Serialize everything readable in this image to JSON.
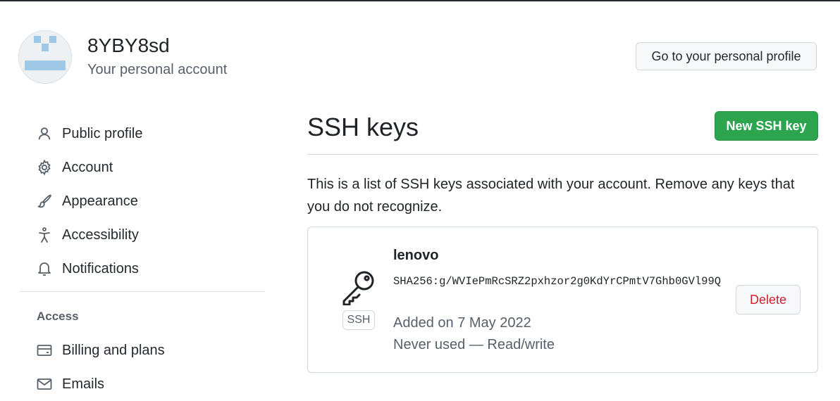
{
  "account": {
    "username": "8YBY8sd",
    "subtitle": "Your personal account",
    "profile_button": "Go to your personal profile"
  },
  "sidebar": {
    "items": [
      {
        "label": "Public profile",
        "icon": "person-icon"
      },
      {
        "label": "Account",
        "icon": "gear-icon"
      },
      {
        "label": "Appearance",
        "icon": "paintbrush-icon"
      },
      {
        "label": "Accessibility",
        "icon": "accessibility-icon"
      },
      {
        "label": "Notifications",
        "icon": "bell-icon"
      }
    ],
    "access_heading": "Access",
    "access_items": [
      {
        "label": "Billing and plans",
        "icon": "credit-card-icon"
      },
      {
        "label": "Emails",
        "icon": "mail-icon"
      }
    ]
  },
  "main": {
    "title": "SSH keys",
    "new_key_button": "New SSH key",
    "description": "This is a list of SSH keys associated with your account. Remove any keys that you do not recognize."
  },
  "keys": [
    {
      "name": "lenovo",
      "type_label": "SSH",
      "fingerprint": "SHA256:g/WVIePmRcSRZ2pxhzor2g0KdYrCPmtV7Ghb0GVl99Q",
      "added": "Added on 7 May 2022",
      "usage": "Never used — Read/write",
      "delete_label": "Delete"
    }
  ],
  "colors": {
    "primary_button": "#2da44e",
    "danger_text": "#cf222e",
    "muted_text": "#57606a",
    "border": "#d0d7de"
  }
}
